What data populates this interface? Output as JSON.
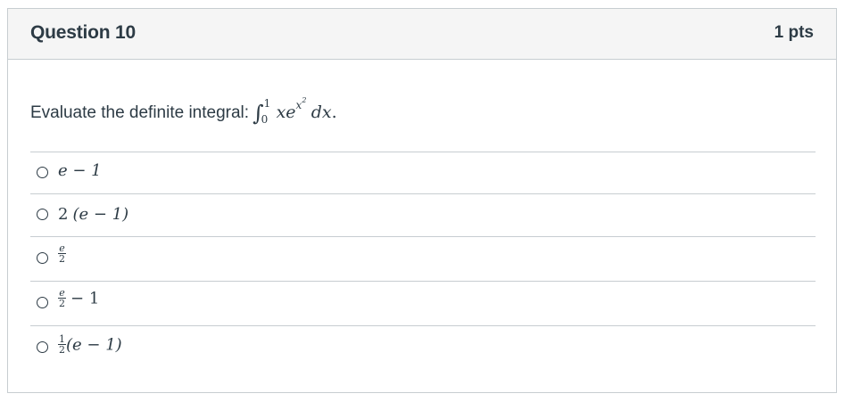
{
  "question": {
    "title": "Question 10",
    "points": "1 pts",
    "prompt_text": "Evaluate the definite integral:",
    "integral": {
      "sign": "∫",
      "upper": "1",
      "lower": "0",
      "integrand_base": "xe",
      "exponent_base": "x",
      "exponent_power": "2",
      "differential": "dx",
      "end": "."
    }
  },
  "answers": [
    {
      "text": "e − 1"
    },
    {
      "coef": "2",
      "paren": "(e − 1)"
    },
    {
      "num": "e",
      "den": "2"
    },
    {
      "num": "e",
      "den": "2",
      "suffix": "− 1"
    },
    {
      "num": "1",
      "den": "2",
      "paren": "(e − 1)"
    }
  ],
  "colors": {
    "text": "#2d3b45",
    "header_bg": "#f5f5f5",
    "border": "#c7cdd1"
  }
}
